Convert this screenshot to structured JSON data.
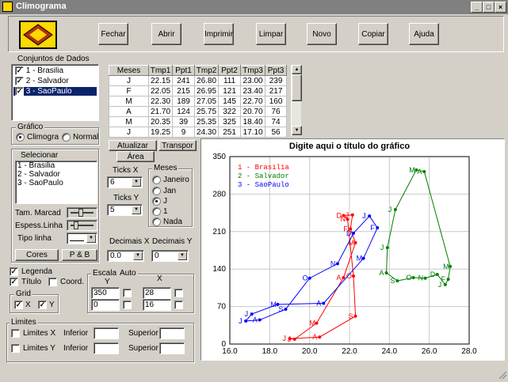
{
  "window": {
    "title": "Climograma"
  },
  "toolbar": {
    "buttons": [
      "Fechar",
      "Abrir",
      "Imprimir",
      "Limpar",
      "Novo",
      "Copiar",
      "Ajuda"
    ]
  },
  "datasets": {
    "label": "Conjuntos de Dados",
    "items": [
      {
        "label": "1 - Brasilia",
        "checked": true
      },
      {
        "label": "2 - Salvador",
        "checked": true
      },
      {
        "label": "3 - SaoPaulo",
        "checked": true
      }
    ]
  },
  "table": {
    "headers": [
      "Meses",
      "Tmp1",
      "Ppt1",
      "Tmp2",
      "Ppt2",
      "Tmp3",
      "Ppt3"
    ],
    "rows": [
      [
        "J",
        "22.15",
        "241",
        "26.80",
        "111",
        "23.00",
        "239"
      ],
      [
        "F",
        "22.05",
        "215",
        "26.95",
        "121",
        "23.40",
        "217"
      ],
      [
        "M",
        "22.30",
        "189",
        "27.05",
        "145",
        "22.70",
        "160"
      ],
      [
        "A",
        "21.70",
        "124",
        "25.75",
        "322",
        "20.70",
        "76"
      ],
      [
        "M",
        "20.35",
        "39",
        "25.35",
        "325",
        "18.40",
        "74"
      ],
      [
        "J",
        "19.25",
        "9",
        "24.30",
        "251",
        "17.10",
        "56"
      ]
    ]
  },
  "grafico": {
    "label": "Gráfico",
    "options": [
      "Climogra",
      "Normal"
    ]
  },
  "actions": {
    "atualizar": "Atualizar",
    "transpor": "Transpor",
    "area": "Área"
  },
  "selecionar": {
    "label": "Selecionar",
    "items": [
      "1 - Brasilia",
      "2 - Salvador",
      "3 - SaoPaulo"
    ]
  },
  "marker": {
    "tam_label": "Tam. Marcad",
    "espess_label": "Espess.Linha",
    "tipo_label": "Tipo linha"
  },
  "buttons": {
    "cores": "Cores",
    "pb": "P & B"
  },
  "ticks": {
    "x_label": "Ticks X",
    "x_value": "6",
    "y_label": "Ticks Y",
    "y_value": "5"
  },
  "meses": {
    "label": "Meses",
    "options": [
      "Janeiro",
      "Jan",
      "J",
      "1",
      "Nada"
    ]
  },
  "decimais": {
    "x_label": "Decimais X",
    "x_value": "0.0",
    "y_label": "Decimais Y",
    "y_value": "0"
  },
  "options": {
    "legenda": "Legenda",
    "titulo": "Título",
    "coord": "Coord."
  },
  "grid": {
    "label": "Grid",
    "x": "X",
    "y": "Y"
  },
  "escala": {
    "label": "Escala",
    "auto": "Auto",
    "y_label": "Y",
    "x_label": "X",
    "y_max": "350",
    "y_min": "0",
    "x_max": "28",
    "x_min": "16"
  },
  "limites": {
    "label": "Limites",
    "x": "Limites X",
    "y": "Limites Y",
    "inferior": "Inferior",
    "superior": "Superior"
  },
  "chart_data": {
    "type": "line",
    "title": "Digite aqui o título do gráfico",
    "xlim": [
      16,
      28
    ],
    "ylim": [
      0,
      350
    ],
    "x_ticks": [
      "16.0",
      "18.0",
      "20.0",
      "22.0",
      "24.0",
      "26.0",
      "28.0"
    ],
    "y_ticks": [
      "0",
      "70",
      "140",
      "210",
      "280",
      "350"
    ],
    "grid": true,
    "legend_position": "top-left",
    "series": [
      {
        "name": "1 - Brasilia",
        "color": "#ff0000",
        "labels": [
          "J",
          "F",
          "M",
          "A",
          "M",
          "J",
          "J",
          "A",
          "S",
          "O",
          "N",
          "D"
        ],
        "x": [
          22.15,
          22.05,
          22.3,
          21.7,
          20.35,
          19.25,
          19.0,
          20.5,
          22.3,
          22.2,
          21.9,
          21.7
        ],
        "y": [
          241,
          215,
          189,
          124,
          39,
          9,
          10,
          13,
          52,
          127,
          233,
          240
        ]
      },
      {
        "name": "2 - Salvador",
        "color": "#008000",
        "labels": [
          "J",
          "F",
          "M",
          "A",
          "M",
          "J",
          "J",
          "A",
          "S",
          "O",
          "N",
          "D"
        ],
        "x": [
          26.8,
          26.95,
          27.05,
          25.75,
          25.35,
          24.3,
          23.9,
          23.85,
          24.4,
          25.2,
          25.8,
          26.4
        ],
        "y": [
          111,
          121,
          145,
          322,
          325,
          251,
          180,
          133,
          118,
          124,
          123,
          130
        ]
      },
      {
        "name": "3 - SaoPaulo",
        "color": "#0000ff",
        "labels": [
          "J",
          "F",
          "M",
          "A",
          "M",
          "J",
          "J",
          "A",
          "S",
          "O",
          "N",
          "D"
        ],
        "x": [
          23.0,
          23.4,
          22.7,
          20.7,
          18.4,
          17.1,
          16.8,
          17.5,
          18.8,
          20.0,
          21.4,
          22.2
        ],
        "y": [
          239,
          217,
          160,
          76,
          74,
          56,
          43,
          45,
          65,
          123,
          150,
          207
        ]
      }
    ]
  }
}
